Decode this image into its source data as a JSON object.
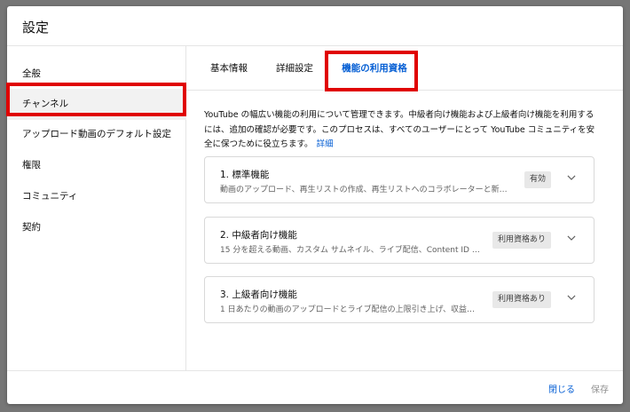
{
  "dialog": {
    "title": "設定"
  },
  "sidebar": {
    "items": [
      {
        "label": "全般"
      },
      {
        "label": "チャンネル"
      },
      {
        "label": "アップロード動画のデフォルト設定"
      },
      {
        "label": "権限"
      },
      {
        "label": "コミュニティ"
      },
      {
        "label": "契約"
      }
    ],
    "active_index": 1
  },
  "tabs": [
    {
      "label": "基本情報"
    },
    {
      "label": "詳細設定"
    },
    {
      "label": "機能の利用資格"
    }
  ],
  "active_tab": 2,
  "description": {
    "text": "YouTube の幅広い機能の利用について管理できます。中級者向け機能および上級者向け機能を利用するには、追加の確認が必要です。このプロセスは、すべてのユーザーにとって YouTube コミュニティを安全に保つために役立ちます。",
    "link": "詳細"
  },
  "features": [
    {
      "title": "1. 標準機能",
      "subtitle": "動画のアップロード、再生リストの作成、再生リストへのコラボレーターと新…",
      "badge": "有効"
    },
    {
      "title": "2. 中級者向け機能",
      "subtitle": "15 分を超える動画、カスタム サムネイル、ライブ配信、Content ID に…",
      "badge": "利用資格あり"
    },
    {
      "title": "3. 上級者向け機能",
      "subtitle": "1 日あたりの動画のアップロードとライブ配信の上限引き上げ、収益…",
      "badge": "利用資格あり"
    }
  ],
  "footer": {
    "close_label": "閉じる",
    "save_label": "保存"
  },
  "colors": {
    "accent": "#065fd4",
    "highlight": "#e00000",
    "backdrop": "#767676"
  },
  "icons": {
    "card_expand": "chevron-down-icon"
  }
}
